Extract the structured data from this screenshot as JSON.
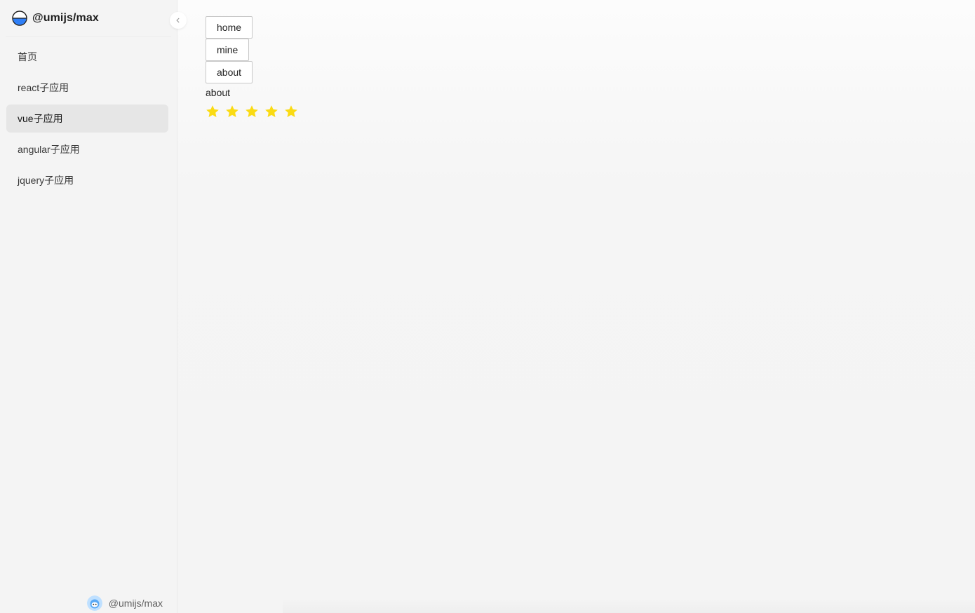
{
  "app": {
    "title": "@umijs/max",
    "logo_icon": "umi-logo-icon"
  },
  "sidebar": {
    "collapse_icon": "chevron-left-icon",
    "items": [
      {
        "label": "首页",
        "selected": false
      },
      {
        "label": "react子应用",
        "selected": false
      },
      {
        "label": "vue子应用",
        "selected": true
      },
      {
        "label": "angular子应用",
        "selected": false
      },
      {
        "label": "jquery子应用",
        "selected": false
      }
    ],
    "footer": {
      "avatar_icon": "user-avatar-icon",
      "username": "@umijs/max"
    }
  },
  "main": {
    "nav_buttons": [
      {
        "label": "home"
      },
      {
        "label": "mine"
      },
      {
        "label": "about"
      }
    ],
    "current_page": "about",
    "rating": {
      "value": 5,
      "max": 5,
      "star_icon": "star-icon"
    }
  },
  "colors": {
    "star": "#fadb14",
    "logo_blue": "#2f7ff7",
    "selected_bg": "#e6e6e6"
  }
}
